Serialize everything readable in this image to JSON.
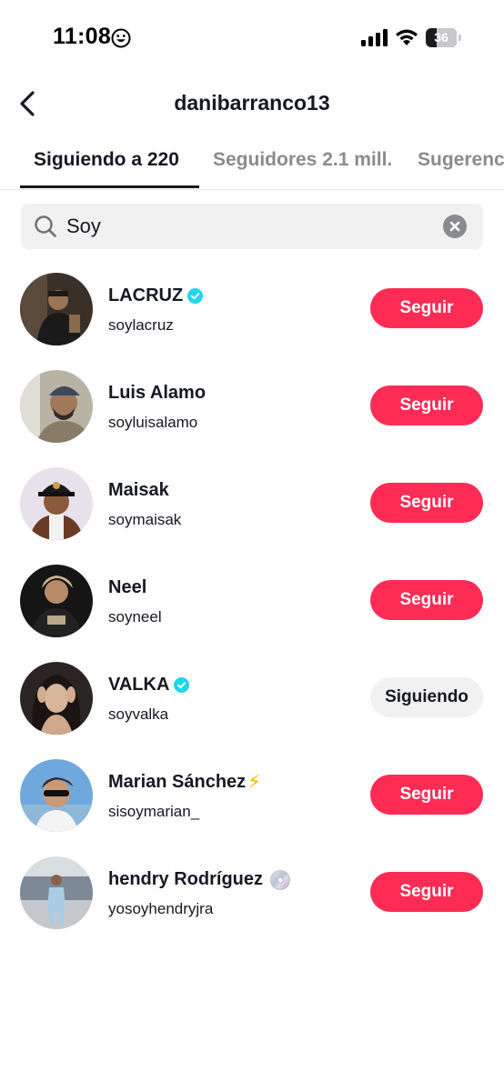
{
  "status_bar": {
    "time": "11:08",
    "battery": "36"
  },
  "header": {
    "title": "danibarranco13"
  },
  "tabs": [
    {
      "label": "Siguiendo a 220",
      "active": true
    },
    {
      "label": "Seguidores 2.1 mill.",
      "active": false
    },
    {
      "label": "Sugerenc",
      "active": false
    }
  ],
  "search": {
    "value": "Soy"
  },
  "users": [
    {
      "name": "LACRUZ",
      "username": "soylacruz",
      "verified": true,
      "button": "Seguir"
    },
    {
      "name": "Luis Alamo",
      "username": "soyluisalamo",
      "verified": false,
      "button": "Seguir"
    },
    {
      "name": "Maisak",
      "username": "soymaisak",
      "verified": false,
      "button": "Seguir"
    },
    {
      "name": "Neel",
      "username": "soyneel",
      "verified": false,
      "button": "Seguir"
    },
    {
      "name": "VALKA",
      "username": "soyvalka",
      "verified": true,
      "button": "Siguiendo"
    },
    {
      "name": "Marian Sánchez",
      "username": "sisoymarian_",
      "verified": false,
      "emoji": "bolt-icon",
      "button": "Seguir"
    },
    {
      "name": "hendry Rodríguez",
      "username": "yosoyhendryjra",
      "verified": false,
      "emoji": "cd-icon",
      "button": "Seguir"
    }
  ],
  "colors": {
    "accent": "#fe2c55",
    "verified": "#20d5ec",
    "text": "#161823",
    "muted": "#8a8b91"
  }
}
